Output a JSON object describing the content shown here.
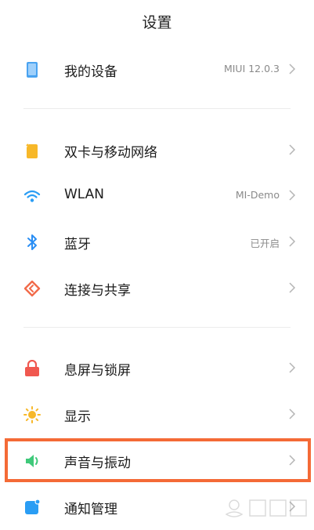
{
  "header": {
    "title": "设置"
  },
  "items": [
    {
      "label": "我的设备",
      "value": "MIUI 12.0.3",
      "icon": "device-icon"
    },
    {
      "label": "双卡与移动网络",
      "value": "",
      "icon": "sim-card-icon"
    },
    {
      "label": "WLAN",
      "value": "MI-Demo",
      "icon": "wifi-icon"
    },
    {
      "label": "蓝牙",
      "value": "已开启",
      "icon": "bluetooth-icon"
    },
    {
      "label": "连接与共享",
      "value": "",
      "icon": "share-icon"
    },
    {
      "label": "息屏与锁屏",
      "value": "",
      "icon": "lock-icon"
    },
    {
      "label": "显示",
      "value": "",
      "icon": "sun-icon"
    },
    {
      "label": "声音与振动",
      "value": "",
      "icon": "speaker-icon"
    },
    {
      "label": "通知管理",
      "value": "",
      "icon": "notification-icon"
    }
  ],
  "colors": {
    "highlight": "#f46a36",
    "device": "#4aa3f0",
    "sim": "#f7b829",
    "wifi": "#2a9df4",
    "bluetooth": "#2a8ef4",
    "share": "#f26b4a",
    "lock": "#f0584f",
    "sun": "#f7b829",
    "speaker": "#3fc97a",
    "notification": "#2a9df4"
  }
}
